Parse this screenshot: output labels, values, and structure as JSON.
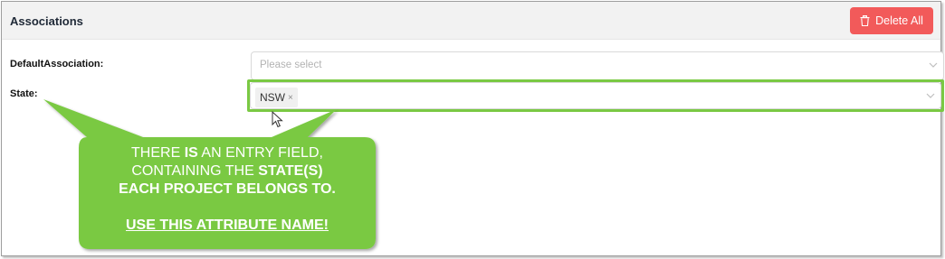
{
  "header": {
    "title": "Associations",
    "delete_all_label": "Delete All",
    "delete_icon": "trash-icon"
  },
  "form": {
    "default_association": {
      "label": "DefaultAssociation:",
      "placeholder": "Please select"
    },
    "state": {
      "label": "State:",
      "tags": [
        {
          "label": "NSW",
          "remove_glyph": "×"
        }
      ]
    }
  },
  "callout": {
    "line1_pre": "THERE ",
    "line1_bold": "IS",
    "line1_post": " AN ENTRY FIELD,",
    "line2_pre": "CONTAINING THE ",
    "line2_bold": "STATE(S)",
    "line3": "EACH PROJECT BELONGS TO.",
    "link_text": "USE THIS ATTRIBUTE NAME!"
  },
  "colors": {
    "accent_green": "#7ac943",
    "delete_red": "#f25a5a"
  }
}
